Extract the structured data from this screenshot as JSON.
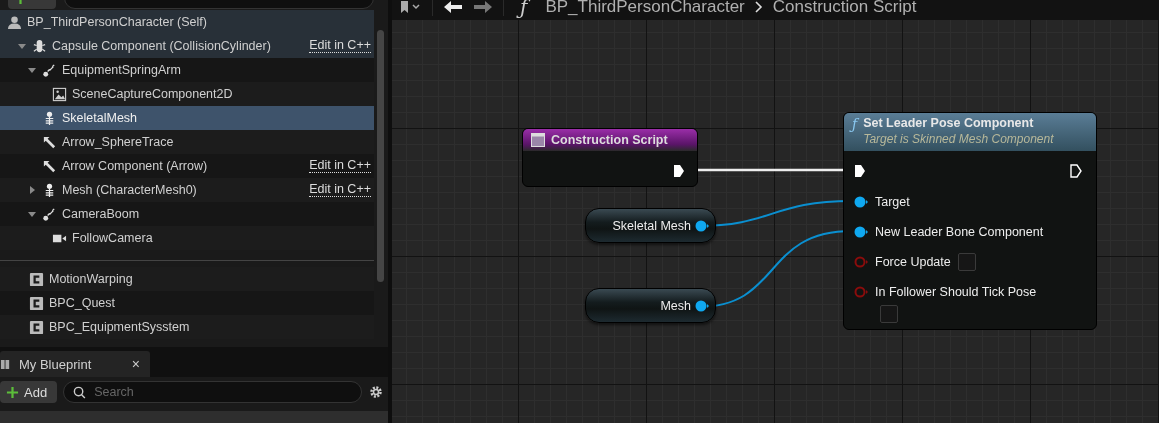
{
  "components_panel": {
    "tree": [
      {
        "label": "BP_ThirdPersonCharacter (Self)",
        "kind": "actor",
        "selected": false,
        "children": [
          {
            "label": "Capsule Component (CollisionCylinder)",
            "kind": "capsule",
            "expanded": true,
            "selected": false,
            "link": "Edit in C++",
            "children": [
              {
                "label": "EquipmentSpringArm",
                "kind": "spring-arm",
                "expanded": true,
                "selected": false,
                "children": [
                  {
                    "label": "SceneCaptureComponent2D",
                    "kind": "scene-capture",
                    "selected": false
                  }
                ]
              },
              {
                "label": "SkeletalMesh",
                "kind": "skeletal",
                "selected": true
              },
              {
                "label": "Arrow_SphereTrace",
                "kind": "arrow",
                "selected": false
              },
              {
                "label": "Arrow Component (Arrow)",
                "kind": "arrow",
                "selected": false,
                "link": "Edit in C++"
              },
              {
                "label": "Mesh (CharacterMesh0)",
                "kind": "skeletal",
                "expanded": false,
                "selected": false,
                "link": "Edit in C++"
              },
              {
                "label": "CameraBoom",
                "kind": "spring-arm",
                "expanded": true,
                "selected": false,
                "children": [
                  {
                    "label": "FollowCamera",
                    "kind": "camera",
                    "selected": false
                  }
                ]
              }
            ]
          }
        ]
      }
    ],
    "other_components": [
      {
        "label": "MotionWarping",
        "selected": false
      },
      {
        "label": "BPC_Quest",
        "selected": false
      },
      {
        "label": "BPC_EquipmentSysstem",
        "selected": false
      }
    ]
  },
  "my_blueprint_panel": {
    "tab": {
      "label": "My Blueprint",
      "close": "×"
    },
    "add_button": "Add",
    "search": {
      "placeholder": "Search"
    }
  },
  "graph_toolbar": {
    "function_glyph": "ƒ",
    "breadcrumb": [
      "BP_ThirdPersonCharacter",
      "Construction Script"
    ]
  },
  "graph": {
    "event_node": {
      "title": "Construction Script"
    },
    "variables": [
      {
        "label": "Skeletal Mesh"
      },
      {
        "label": "Mesh"
      }
    ],
    "function_node": {
      "glyph": "ƒ",
      "title": "Set Leader Pose Component",
      "subtitle": "Target is Skinned Mesh Component",
      "pins": [
        {
          "label": "Target",
          "kind": "object",
          "connected": true
        },
        {
          "label": "New Leader Bone Component",
          "kind": "object",
          "connected": true
        },
        {
          "label": "Force Update",
          "kind": "bool",
          "connected": false,
          "checked": false
        },
        {
          "label": "In Follower Should Tick Pose",
          "kind": "bool",
          "connected": false,
          "checked": false
        }
      ]
    }
  }
}
